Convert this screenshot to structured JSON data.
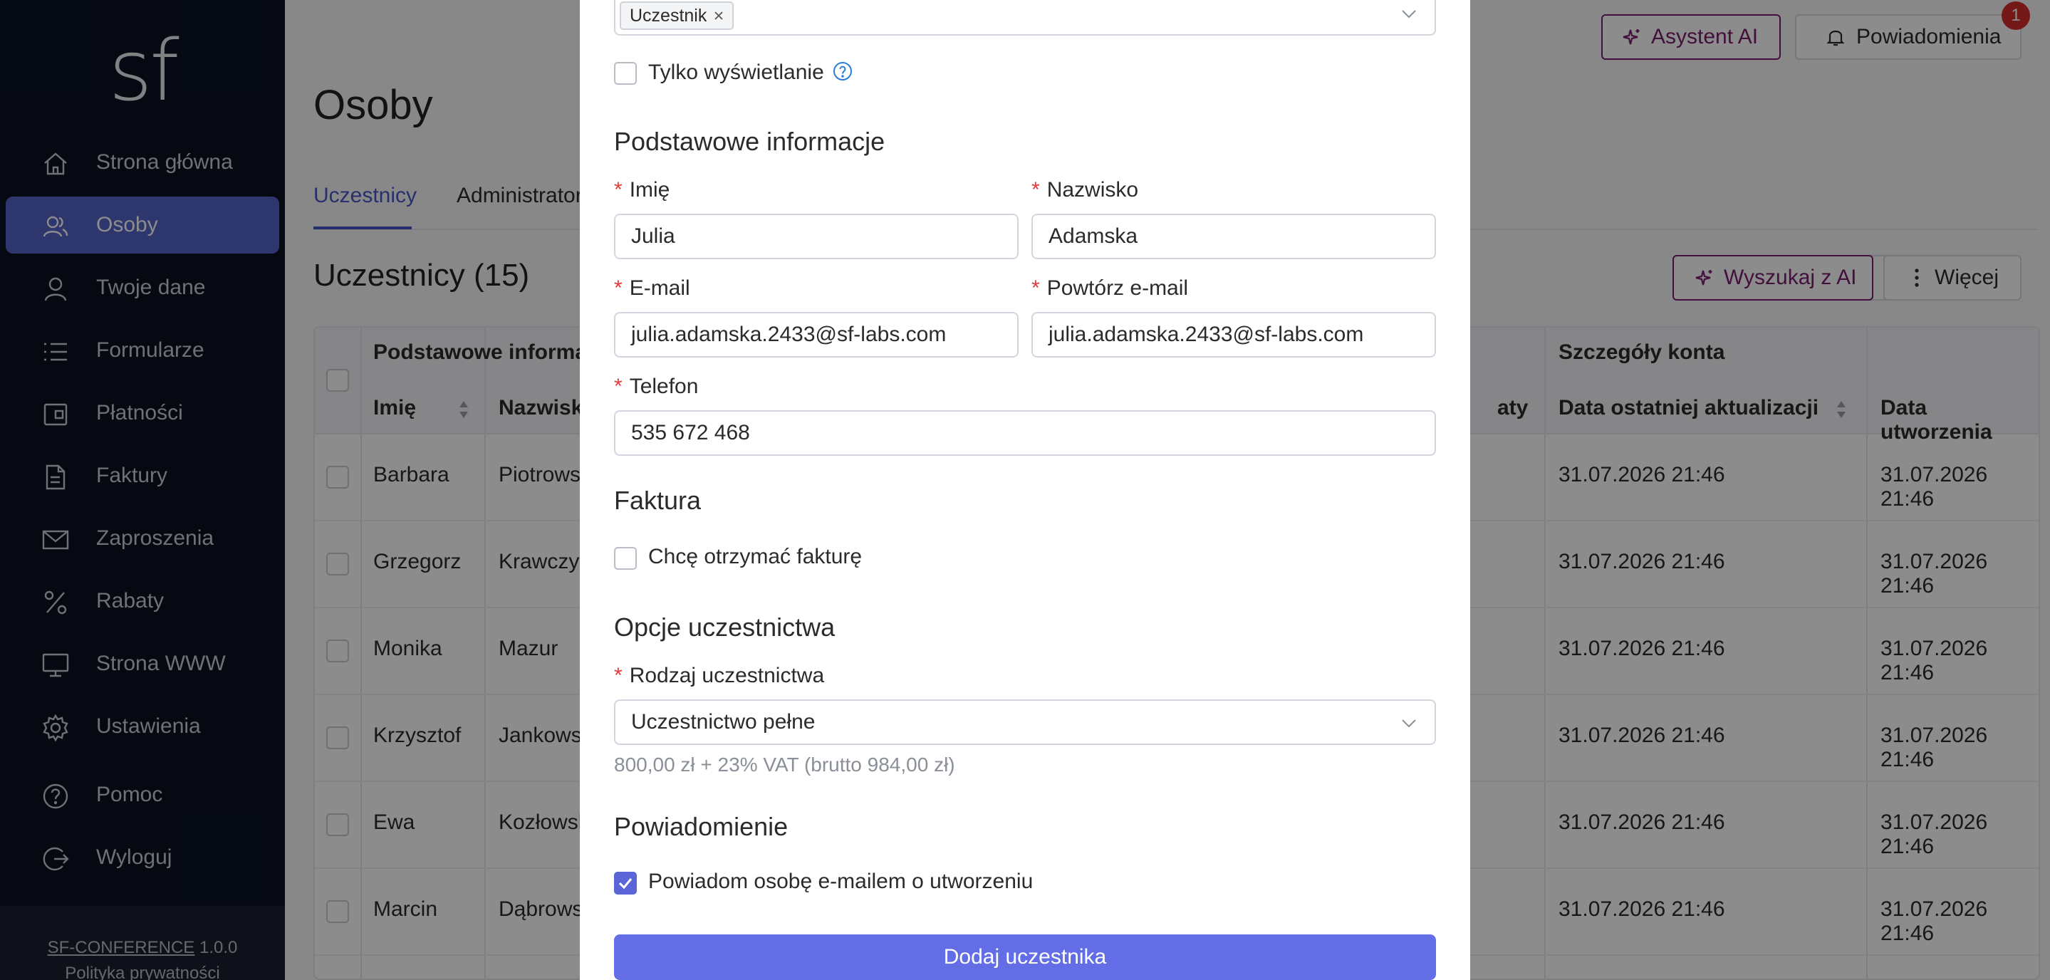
{
  "sidebar": {
    "logo": "sf",
    "items": [
      {
        "label": "Strona główna",
        "icon": "home-icon"
      },
      {
        "label": "Osoby",
        "icon": "people-icon",
        "active": true
      },
      {
        "label": "Twoje dane",
        "icon": "user-icon"
      },
      {
        "label": "Formularze",
        "icon": "list-icon"
      },
      {
        "label": "Płatności",
        "icon": "wallet-icon"
      },
      {
        "label": "Faktury",
        "icon": "document-icon"
      },
      {
        "label": "Zaproszenia",
        "icon": "envelope-icon"
      },
      {
        "label": "Rabaty",
        "icon": "percent-icon"
      },
      {
        "label": "Strona WWW",
        "icon": "monitor-icon"
      },
      {
        "label": "Ustawienia",
        "icon": "gear-icon"
      },
      {
        "label": "Pomoc",
        "icon": "help-icon"
      },
      {
        "label": "Wyloguj",
        "icon": "logout-icon"
      }
    ],
    "footer": {
      "product": "SF-CONFERENCE",
      "version": "1.0.0",
      "privacy": "Polityka prywatności"
    }
  },
  "header": {
    "ai_assistant": "Asystent AI",
    "notifications": "Powiadomienia",
    "notifications_count": "1"
  },
  "page": {
    "title": "Osoby",
    "tabs": [
      "Uczestnicy",
      "Administrator"
    ],
    "section_title": "Uczestnicy (15)",
    "search_ai": "Wyszukaj z AI",
    "more": "Więcej"
  },
  "table": {
    "group_basic": "Podstawowe informa",
    "group_account": "Szczegóły konta",
    "col_first": "Imię",
    "col_last": "Nazwisk",
    "col_partial": "aty",
    "col_updated": "Data ostatniej aktualizacji",
    "col_created": "Data utworzenia",
    "rows": [
      {
        "first": "Barbara",
        "last": "Piotrows",
        "updated": "31.07.2026 21:46",
        "created": "31.07.2026 21:46"
      },
      {
        "first": "Grzegorz",
        "last": "Krawczyk",
        "updated": "31.07.2026 21:46",
        "created": "31.07.2026 21:46"
      },
      {
        "first": "Monika",
        "last": "Mazur",
        "updated": "31.07.2026 21:46",
        "created": "31.07.2026 21:46"
      },
      {
        "first": "Krzysztof",
        "last": "Jankowsk",
        "updated": "31.07.2026 21:46",
        "created": "31.07.2026 21:46"
      },
      {
        "first": "Ewa",
        "last": "Kozłowsk",
        "updated": "31.07.2026 21:46",
        "created": "31.07.2026 21:46"
      },
      {
        "first": "Marcin",
        "last": "Dąbrows",
        "updated": "31.07.2026 21:46",
        "created": "31.07.2026 21:46"
      }
    ]
  },
  "modal": {
    "role_chip": "Uczestnik",
    "view_only": "Tylko wyświetlanie",
    "basic_info": "Podstawowe informacje",
    "first_name_label": "Imię",
    "first_name_value": "Julia",
    "last_name_label": "Nazwisko",
    "last_name_value": "Adamska",
    "email_label": "E-mail",
    "email_value": "julia.adamska.2433@sf-labs.com",
    "email_repeat_label": "Powtórz e-mail",
    "email_repeat_value": "julia.adamska.2433@sf-labs.com",
    "phone_label": "Telefon",
    "phone_value": "535 672 468",
    "invoice_heading": "Faktura",
    "invoice_checkbox": "Chcę otrzymać fakturę",
    "participation_heading": "Opcje uczestnictwa",
    "participation_type_label": "Rodzaj uczestnictwa",
    "participation_type_value": "Uczestnictwo pełne",
    "participation_price": "800,00 zł + 23% VAT (brutto 984,00 zł)",
    "notification_heading": "Powiadomienie",
    "notify_checkbox": "Powiadom osobę e-mailem o utworzeniu",
    "notify_checked": true,
    "submit": "Dodaj uczestnika"
  },
  "colors": {
    "accent": "#5563c9",
    "ai": "#7a1c6f",
    "sidebar": "#0b1220",
    "submit": "#636ee6",
    "badge": "#d62d2d"
  }
}
